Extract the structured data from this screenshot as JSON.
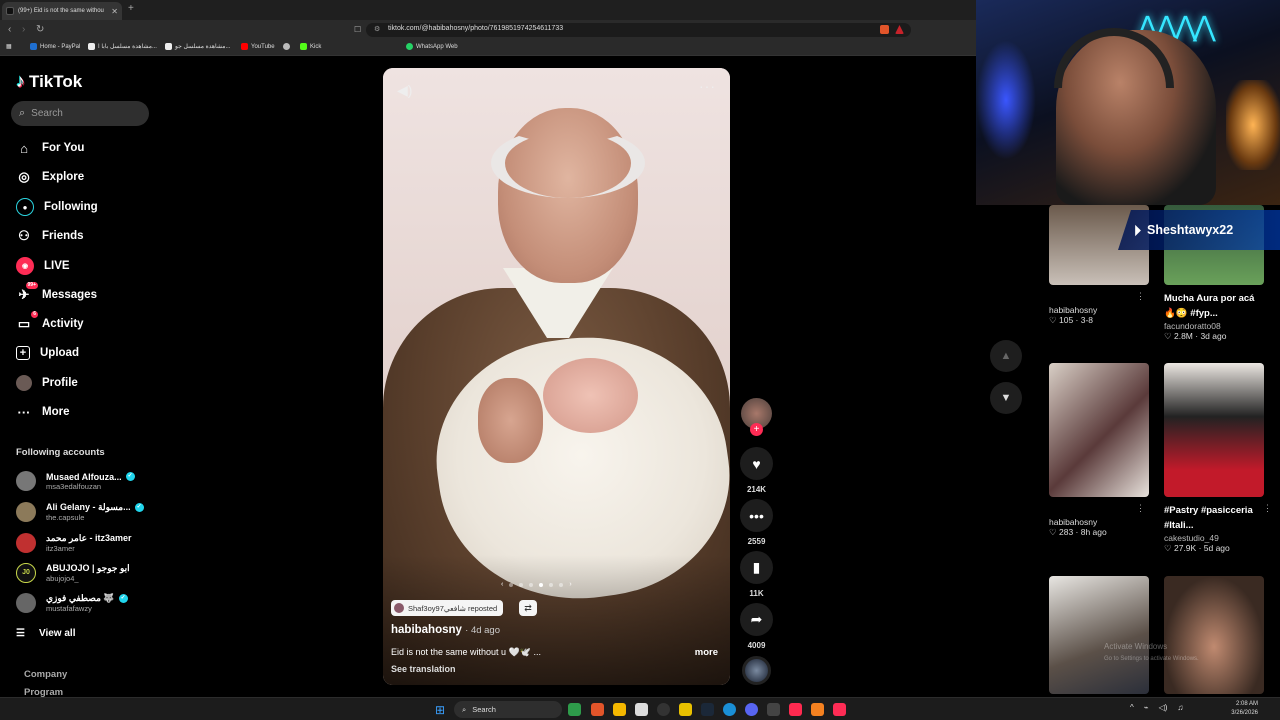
{
  "browser": {
    "tab_title": "(99+) Eid is not the same withou",
    "url": "tiktok.com/@habibahosny/photo/7619851974254611733",
    "bookmarks": [
      "Home - PayPal",
      "مشاهدة مسلسل بابا ا...",
      "مشاهدة مسلسل جو...",
      "YouTube",
      "Kick",
      "WhatsApp Web"
    ]
  },
  "sidebar": {
    "logo": "TikTok",
    "search_placeholder": "Search",
    "nav": [
      {
        "label": "For You",
        "icon": "home-icon"
      },
      {
        "label": "Explore",
        "icon": "compass-icon"
      },
      {
        "label": "Following",
        "icon": "following-icon"
      },
      {
        "label": "Friends",
        "icon": "friends-icon"
      },
      {
        "label": "LIVE",
        "icon": "live-icon"
      },
      {
        "label": "Messages",
        "icon": "messages-icon",
        "badge": "99+"
      },
      {
        "label": "Activity",
        "icon": "activity-icon",
        "badge": "6"
      },
      {
        "label": "Upload",
        "icon": "upload-icon"
      },
      {
        "label": "Profile",
        "icon": "profile-icon"
      },
      {
        "label": "More",
        "icon": "more-icon"
      }
    ],
    "following_title": "Following accounts",
    "accounts": [
      {
        "name": "Musaed Alfouza...",
        "handle": "msa3edalfouzan",
        "verified": true
      },
      {
        "name": "Ali Gelany - مسولة...",
        "handle": "the.capsule",
        "verified": true
      },
      {
        "name": "عامر محمد - itz3amer",
        "handle": "itz3amer",
        "verified": false
      },
      {
        "name": "ABUJOJO | ابو جوجو",
        "handle": "abujojo4_",
        "verified": false
      },
      {
        "name": "مصطفي فوزي 🐺",
        "handle": "mustafafawzy",
        "verified": true
      }
    ],
    "view_all": "View all",
    "footer": [
      "Company",
      "Program"
    ]
  },
  "video": {
    "reposted_by": "Shaf3oy97شافعي reposted",
    "author": "habibahosny",
    "date": "· 4d ago",
    "caption": "Eid is not the same without u 🤍🕊️ ...",
    "more": "more",
    "translate": "See translation",
    "likes": "214K",
    "comments": "2559",
    "saves": "11K",
    "shares": "4009"
  },
  "grid": [
    {
      "title": "",
      "user": "habibahosny",
      "likes": "105",
      "age": "3-8"
    },
    {
      "title": "Mucha Aura por acá 🔥😳 #fyp...",
      "user": "facundoratto08",
      "likes": "2.8M",
      "age": "3d ago"
    },
    {
      "title": "",
      "user": "habibahosny",
      "likes": "283",
      "age": "8h ago"
    },
    {
      "title": "#Pastry #pasicceria #Itali...",
      "user": "cakestudio_49",
      "likes": "27.9K",
      "age": "5d ago"
    }
  ],
  "overlay": {
    "streamer": "Sheshtawyx22",
    "activate_line1": "Activate Windows",
    "activate_line2": "Go to Settings to activate Windows."
  },
  "taskbar": {
    "search": "Search",
    "time": "2:08 AM",
    "date": "3/26/2026"
  }
}
